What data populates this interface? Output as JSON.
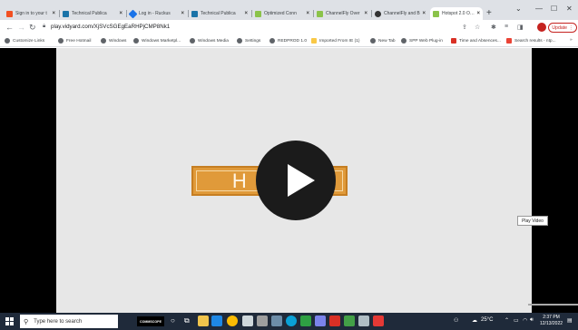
{
  "browser": {
    "tabs": [
      {
        "title": "Sign in to your t",
        "favicon_color": "#f25022"
      },
      {
        "title": "Technical Publica",
        "favicon_color": "#1a73a8"
      },
      {
        "title": "Log in - Ruckus",
        "favicon_color": "#1a73e8"
      },
      {
        "title": "Technical Publica",
        "favicon_color": "#1a73a8"
      },
      {
        "title": "Optimized Conn",
        "favicon_color": "#8bc34a"
      },
      {
        "title": "ChannelFly Over",
        "favicon_color": "#8bc34a"
      },
      {
        "title": "ChannelFly and B",
        "favicon_color": "#333333"
      },
      {
        "title": "Hotspot 2.0 Over",
        "favicon_color": "#8bc34a"
      }
    ],
    "active_tab_index": 7,
    "new_tab_symbol": "+",
    "window_controls": {
      "dropdown": "⌄",
      "minimize": "—",
      "maximize": "☐",
      "close": "✕"
    },
    "url": "play.vidyard.com/XjSVcSGEgEaRHPjCMP8Nk1",
    "update_label": "Update",
    "bookmarks": [
      {
        "label": "Customize Links",
        "icon": "globe-icon"
      },
      {
        "label": "Free Hotmail",
        "icon": "globe-icon"
      },
      {
        "label": "Windows",
        "icon": "globe-icon"
      },
      {
        "label": "Windows Marketpl...",
        "icon": "globe-icon"
      },
      {
        "label": "Windows Media",
        "icon": "globe-icon"
      },
      {
        "label": "Settings",
        "icon": "globe-icon"
      },
      {
        "label": "REDPROD 1.0",
        "icon": "globe-icon"
      },
      {
        "label": "Imported From IE (1)",
        "icon": "folder-icon"
      },
      {
        "label": "New Tab",
        "icon": "globe-icon"
      },
      {
        "label": "SPP Web Plug-in",
        "icon": "globe-icon"
      },
      {
        "label": "Time and Absences...",
        "icon": "red-square-icon"
      },
      {
        "label": "Search results - ntp...",
        "icon": "gmail-icon"
      },
      {
        "label": "»",
        "icon": "chevron-icon"
      }
    ]
  },
  "video": {
    "banner_title": "H    0",
    "tooltip": "Play Video"
  },
  "taskbar": {
    "search_placeholder": "Type here to search",
    "commscope_label": "COMMSCOPE",
    "weather": "25°C",
    "time": "2:37 PM",
    "date": "12/13/2022"
  },
  "colors": {
    "tab_strip": "#dee1e6",
    "video_bg": "#e7e7e7",
    "banner": "#e09a3a",
    "play_button": "#1b1b1b",
    "taskbar": "#1f2a3a",
    "update_red": "#c5221f"
  }
}
